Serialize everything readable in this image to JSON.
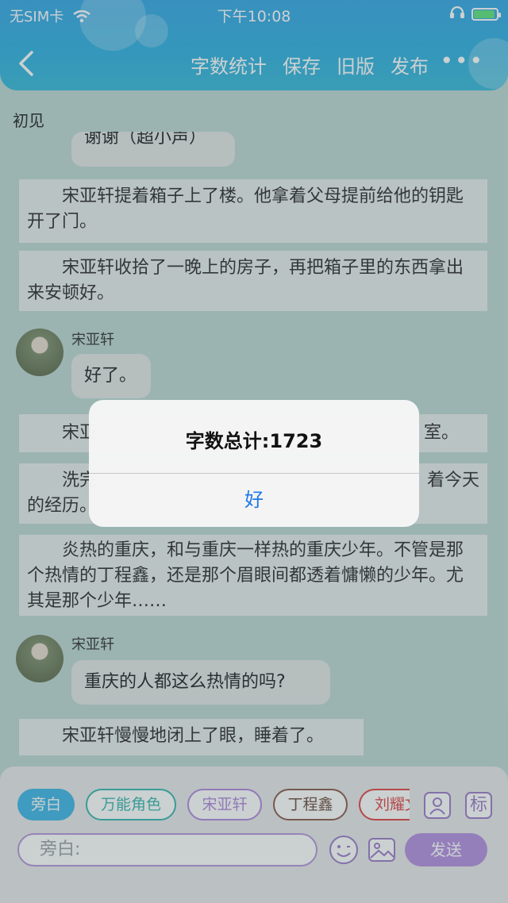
{
  "status_bar": {
    "carrier": "无SIM卡",
    "time": "下午10:08"
  },
  "header": {
    "nav": [
      {
        "label": "字数统计"
      },
      {
        "label": "保存"
      },
      {
        "label": "旧版"
      },
      {
        "label": "发布"
      }
    ],
    "more": "•••"
  },
  "story": {
    "title": "初见",
    "partial_top": "谢谢（超小声）",
    "blocks": [
      "宋亚轩提着箱子上了楼。他拿着父母提前给他的钥匙开了门。",
      "宋亚轩收拾了一晚上的房子，再把箱子里的东西拿出来安顿好。",
      "宋亚",
      "室。",
      "洗完",
      "着今天",
      "的经历。",
      "炎热的重庆，和与重庆一样热的重庆少年。不管是那个热情的丁程鑫，还是那个眉眼间都透着慵懒的少年。尤其是那个少年……",
      "宋亚轩慢慢地闭上了眼，睡着了。"
    ],
    "chat": [
      {
        "name": "宋亚轩",
        "text": "好了。"
      },
      {
        "name": "宋亚轩",
        "text": "重庆的人都这么热情的吗?"
      }
    ]
  },
  "dialog": {
    "title": "字数总计:1723",
    "button": "好"
  },
  "bottom": {
    "chips": [
      "旁白",
      "万能角色",
      "宋亚轩",
      "丁程鑫",
      "刘耀文"
    ],
    "tag_button": "标",
    "input_placeholder": "旁白:",
    "send": "发送"
  }
}
